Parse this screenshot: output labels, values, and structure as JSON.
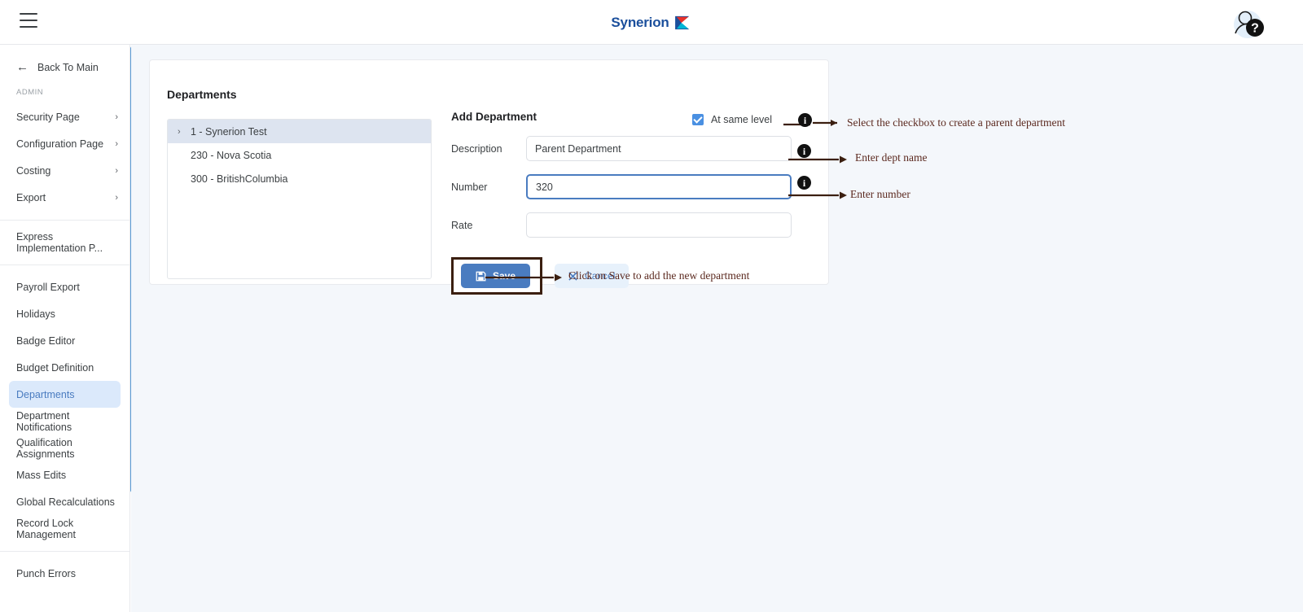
{
  "topbar": {
    "menu_icon": "hamburger-menu-icon",
    "brand_name": "Synerion",
    "help_icon": "help-avatar-icon"
  },
  "sidebar": {
    "back_label": "Back To Main",
    "back_icon": "arrow-left-icon",
    "section_label": "ADMIN",
    "group1": [
      {
        "label": "Security Page",
        "chevron": "›"
      },
      {
        "label": "Configuration Page",
        "chevron": "›"
      },
      {
        "label": "Costing",
        "chevron": "›"
      },
      {
        "label": "Export",
        "chevron": "›"
      }
    ],
    "group2": [
      {
        "label": "Express Implementation P..."
      }
    ],
    "group3": [
      {
        "label": "Payroll Export"
      },
      {
        "label": "Holidays"
      },
      {
        "label": "Badge Editor"
      },
      {
        "label": "Budget Definition"
      },
      {
        "label": "Departments"
      },
      {
        "label": "Department Notifications"
      },
      {
        "label": "Qualification Assignments"
      },
      {
        "label": "Mass Edits"
      },
      {
        "label": "Global Recalculations"
      },
      {
        "label": "Record Lock Management"
      }
    ],
    "group4": [
      {
        "label": "Punch Errors"
      }
    ],
    "active_item": "Departments",
    "scrollbar_color": "#5b9bd5"
  },
  "main": {
    "card_title": "Departments",
    "tree": [
      {
        "label": "1 - Synerion Test",
        "caret": "›",
        "selected": true,
        "child": false
      },
      {
        "label": "230 - Nova Scotia",
        "caret": "",
        "selected": false,
        "child": true
      },
      {
        "label": "300 - BritishColumbia",
        "caret": "",
        "selected": false,
        "child": true
      }
    ],
    "form": {
      "title": "Add Department",
      "same_level_label": "At same level",
      "same_level_checked": true,
      "fields": [
        {
          "label": "Description",
          "value": "Parent Department",
          "focused": false
        },
        {
          "label": "Number",
          "value": "320",
          "focused": true
        },
        {
          "label": "Rate",
          "value": "",
          "focused": false
        }
      ],
      "save_label": "Save",
      "save_icon": "floppy-disk-icon",
      "cancel_label": "Cancel",
      "cancel_icon": "close-x-icon"
    }
  },
  "annotations": [
    {
      "text": "Select the checkbox to create a parent department",
      "icon": "info-circle-icon"
    },
    {
      "text": "Enter dept name",
      "icon": "info-circle-icon"
    },
    {
      "text": "Enter number",
      "icon": "info-circle-icon"
    },
    {
      "text": "Click on Save to add the new department",
      "icon": ""
    }
  ],
  "colors": {
    "brand": "#1b4f9c",
    "accent": "#4a7cc0",
    "annotation": "#5c2a20",
    "content_bg": "#f4f7fb"
  }
}
